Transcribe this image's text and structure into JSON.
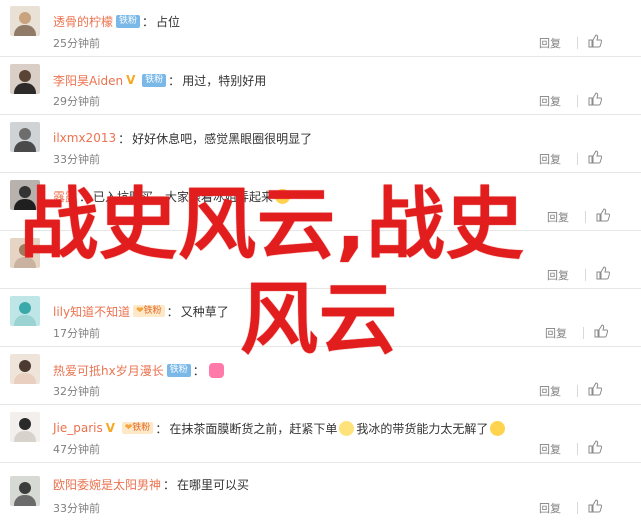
{
  "comments": [
    {
      "user": "透骨的柠檬",
      "badges": [
        "icon"
      ],
      "icon_label": "铁粉",
      "sep": "：",
      "text": "占位",
      "time": "25分钟前",
      "reply": "回复",
      "emoji": []
    },
    {
      "user": "李阳昊Aiden",
      "badges": [
        "v",
        "icon"
      ],
      "icon_label": "铁粉",
      "sep": "：",
      "text": "用过，特别好用",
      "time": "29分钟前",
      "reply": "回复",
      "emoji": []
    },
    {
      "user": "ilxmx2013",
      "badges": [],
      "sep": "：",
      "text": "好好休息吧，感觉黑眼圈很明显了",
      "time": "33分钟前",
      "reply": "回复",
      "emoji": []
    },
    {
      "user": "露露",
      "badges": [],
      "sep": "：",
      "text": "已入坑购买，大家跟着冰姐弄起来",
      "time": "",
      "reply": "回复",
      "emoji": []
    },
    {
      "user": "",
      "badges": [],
      "sep": "",
      "text": "",
      "time": "",
      "reply": "回复",
      "emoji": []
    },
    {
      "user": "lily知道不知道",
      "badges": [
        "fan"
      ],
      "fan_label": "铁粉",
      "sep": "：",
      "text": "又种草了",
      "time": "17分钟前",
      "reply": "回复",
      "emoji": []
    },
    {
      "user": "热爱可抵hx岁月漫长",
      "badges": [
        "icon"
      ],
      "icon_label": "铁粉",
      "sep": "：",
      "text": "",
      "time": "32分钟前",
      "reply": "回复",
      "emoji": [
        "heart"
      ]
    },
    {
      "user": "Jie_paris",
      "badges": [
        "v",
        "fan"
      ],
      "fan_label": "铁粉",
      "sep": "：",
      "text": "在抹茶面膜断货之前，赶紧下单",
      "text2": "我冰的带货能力太无解了",
      "time": "47分钟前",
      "reply": "回复",
      "emoji": [
        "cat",
        "smile"
      ]
    },
    {
      "user": "欧阳委婉是太阳男神",
      "badges": [],
      "sep": "：",
      "text": "在哪里可以买",
      "time": "33分钟前",
      "reply": "回复",
      "emoji": []
    }
  ],
  "overlay": {
    "line1": "战史风云,战史",
    "line2": "风云"
  },
  "colors": {
    "username": "#eb7350",
    "overlay": "#e11d1d",
    "meta": "#808080"
  }
}
